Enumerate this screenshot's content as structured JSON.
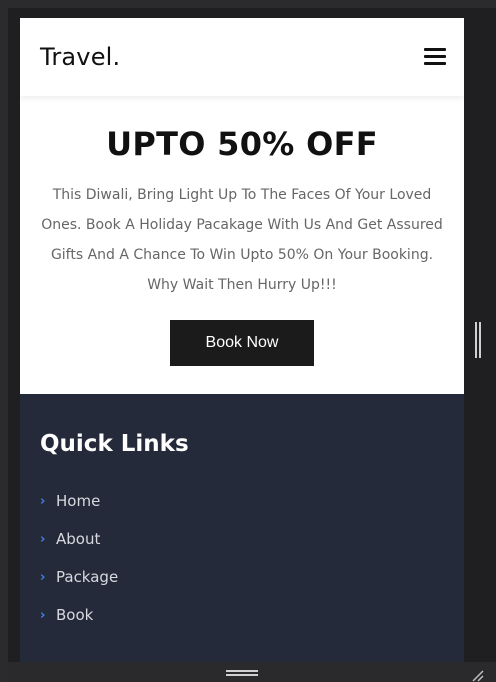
{
  "header": {
    "logo": "Travel.",
    "menu_icon": "hamburger-menu-icon"
  },
  "banner": {
    "title": "UPTO 50% OFF",
    "text": "This Diwali, Bring Light Up To The Faces Of Your Loved Ones. Book A Holiday Pacakage With Us And Get Assured Gifts And A Chance To Win Upto 50% On Your Booking. Why Wait Then Hurry Up!!!",
    "button_label": "Book Now"
  },
  "footer": {
    "title": "Quick Links",
    "links": [
      {
        "label": "Home",
        "icon": "chevron-right-icon"
      },
      {
        "label": "About",
        "icon": "chevron-right-icon"
      },
      {
        "label": "Package",
        "icon": "chevron-right-icon"
      },
      {
        "label": "Book",
        "icon": "chevron-right-icon"
      }
    ]
  },
  "colors": {
    "accent": "#3b82f6",
    "header_bg": "#ffffff",
    "footer_bg": "#252a3a",
    "button_bg": "#1b1b1b"
  }
}
